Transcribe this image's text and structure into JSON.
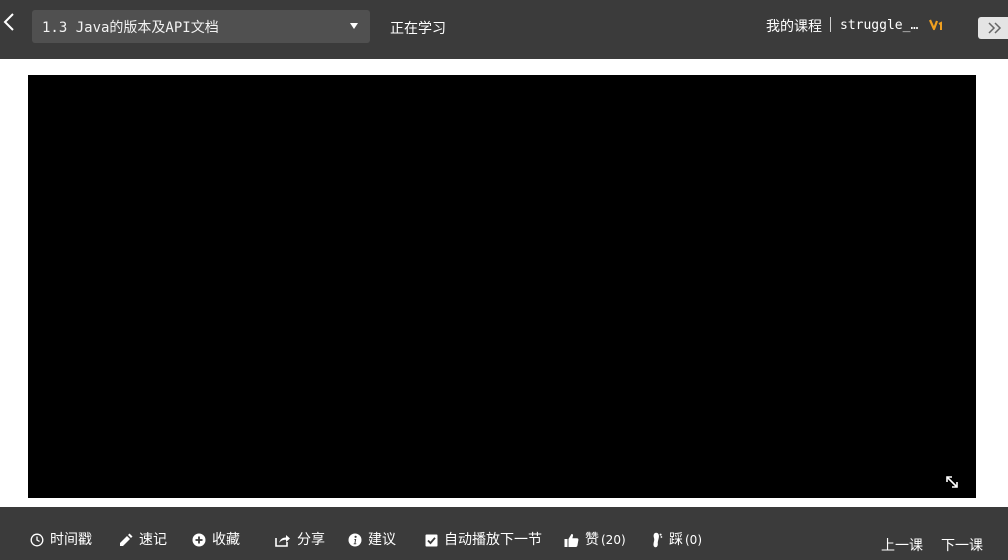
{
  "header": {
    "lesson_title": "1.3 Java的版本及API文档",
    "status_text": "正在学习",
    "my_courses_label": "我的课程",
    "username": "struggle_…"
  },
  "toolbar": {
    "timestamp_label": "时间戳",
    "notes_label": "速记",
    "favorite_label": "收藏",
    "share_label": "分享",
    "suggest_label": "建议",
    "autoplay_label": "自动播放下一节",
    "autoplay_checked": true,
    "like_label": "赞",
    "like_count": "(20)",
    "dislike_label": "踩",
    "dislike_count": "(0)",
    "prev_label": "上一课",
    "next_label": "下一课"
  },
  "colors": {
    "bar_bg": "#3b3b3b",
    "select_bg": "#505050",
    "video_bg": "#000000",
    "vip_accent": "#f0a020"
  },
  "icons": [
    "back-chevron-icon",
    "dropdown-arrow-icon",
    "vip-icon",
    "double-chevron-right-icon",
    "fullscreen-icon",
    "clock-icon",
    "pencil-icon",
    "plus-circle-icon",
    "share-icon",
    "info-icon",
    "checkbox-icon",
    "thumbs-up-icon",
    "footprint-icon"
  ]
}
